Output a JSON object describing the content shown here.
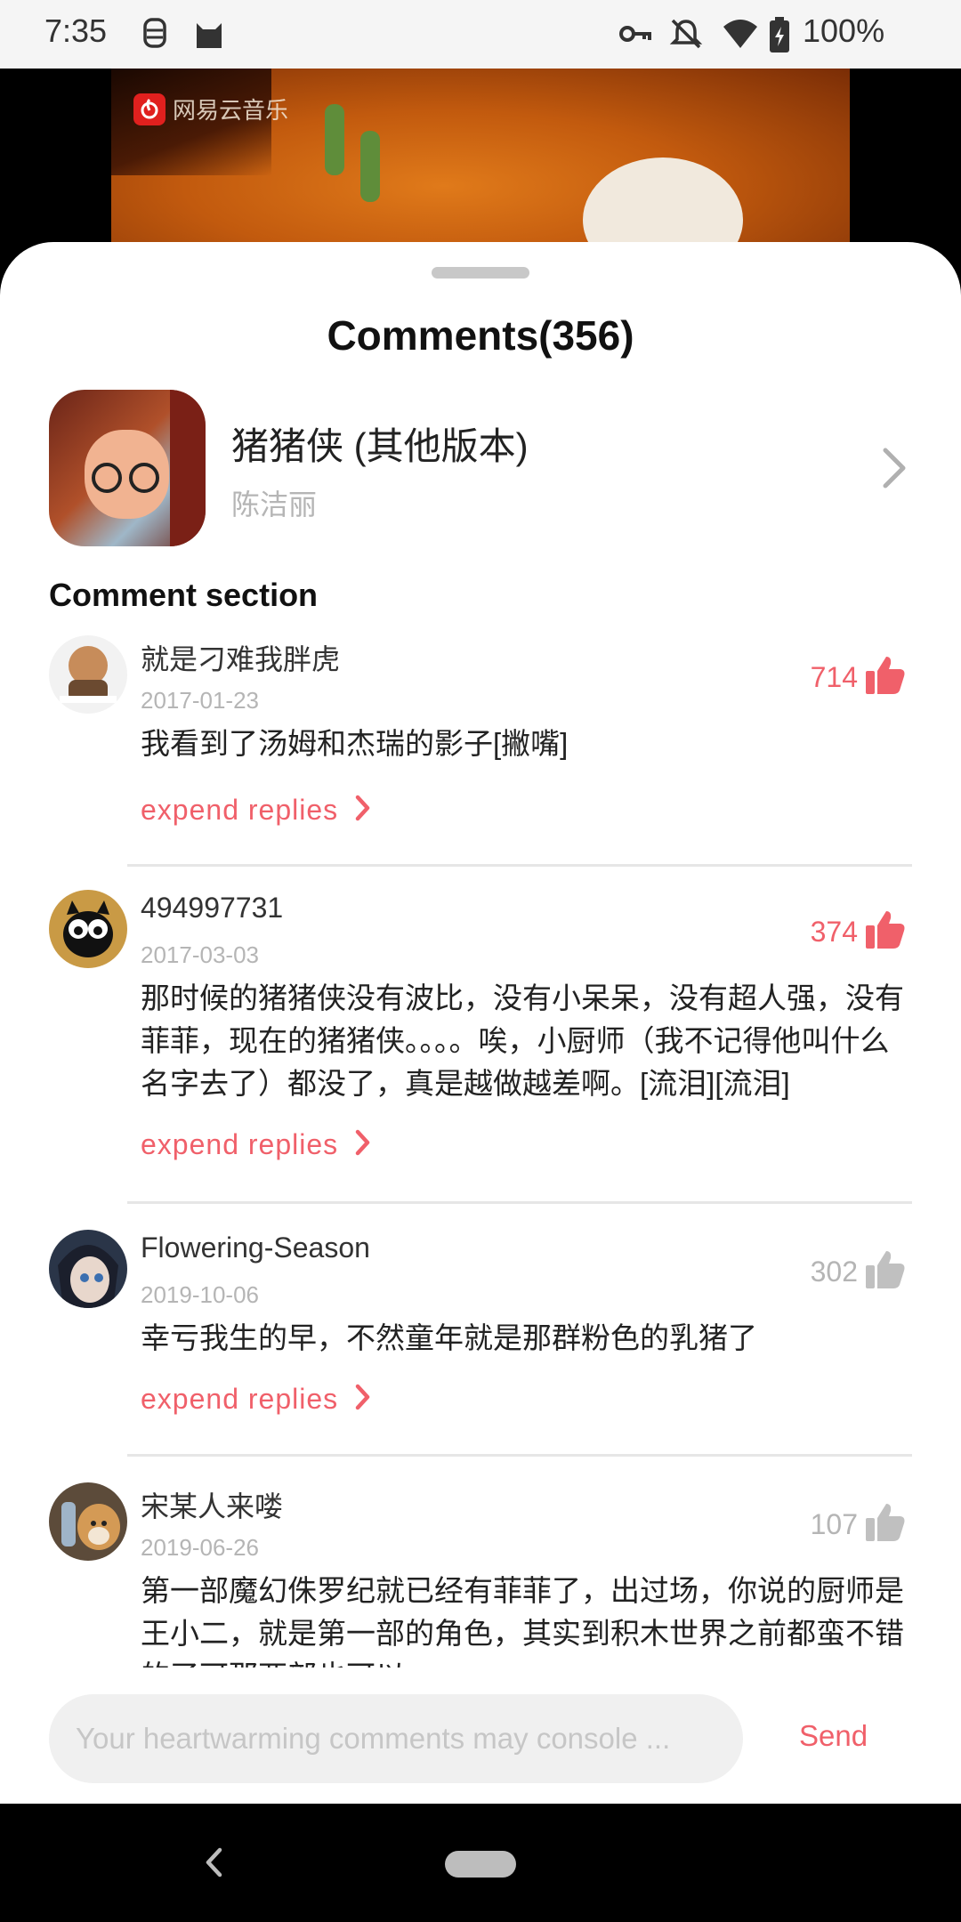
{
  "status_bar": {
    "time": "7:35",
    "battery": "100%",
    "icons": [
      "face-icon",
      "cat-icon",
      "key-icon",
      "mute-bell-icon",
      "wifi-icon",
      "battery-charging-icon"
    ]
  },
  "video": {
    "watermark": "网易云音乐"
  },
  "sheet": {
    "title": "Comments(356)",
    "song": {
      "title": "猪猪侠 (其他版本)",
      "artist": "陈洁丽"
    },
    "section_title": "Comment section"
  },
  "comments": [
    {
      "name": "就是刁难我胖虎",
      "date": "2017-01-23",
      "likes": "714",
      "liked": true,
      "text": "我看到了汤姆和杰瑞的影子[撇嘴]",
      "replies_label": "expend replies"
    },
    {
      "name": "494997731",
      "date": "2017-03-03",
      "likes": "374",
      "liked": true,
      "text": "那时候的猪猪侠没有波比，没有小呆呆，没有超人强，没有菲菲，现在的猪猪侠。。。。唉，小厨师（我不记得他叫什么名字去了）都没了，真是越做越差啊。[流泪][流泪]",
      "replies_label": "expend replies"
    },
    {
      "name": "Flowering-Season",
      "date": "2019-10-06",
      "likes": "302",
      "liked": false,
      "text": "幸亏我生的早，不然童年就是那群粉色的乳猪了",
      "replies_label": "expend replies"
    },
    {
      "name": "宋某人来喽",
      "date": "2019-06-26",
      "likes": "107",
      "liked": false,
      "text": "第一部魔幻侏罗纪就已经有菲菲了，出过场，你说的厨师是王小二，就是第一部的角色，其实到积木世界之前都蛮不错的了可那两部也可以"
    }
  ],
  "input": {
    "placeholder": "Your heartwarming comments may console ...",
    "send_label": "Send"
  },
  "colors": {
    "accent": "#f0606a",
    "muted": "#b5b5b5",
    "like_active": "#f0606a",
    "like_inactive": "#c0c0c0"
  }
}
